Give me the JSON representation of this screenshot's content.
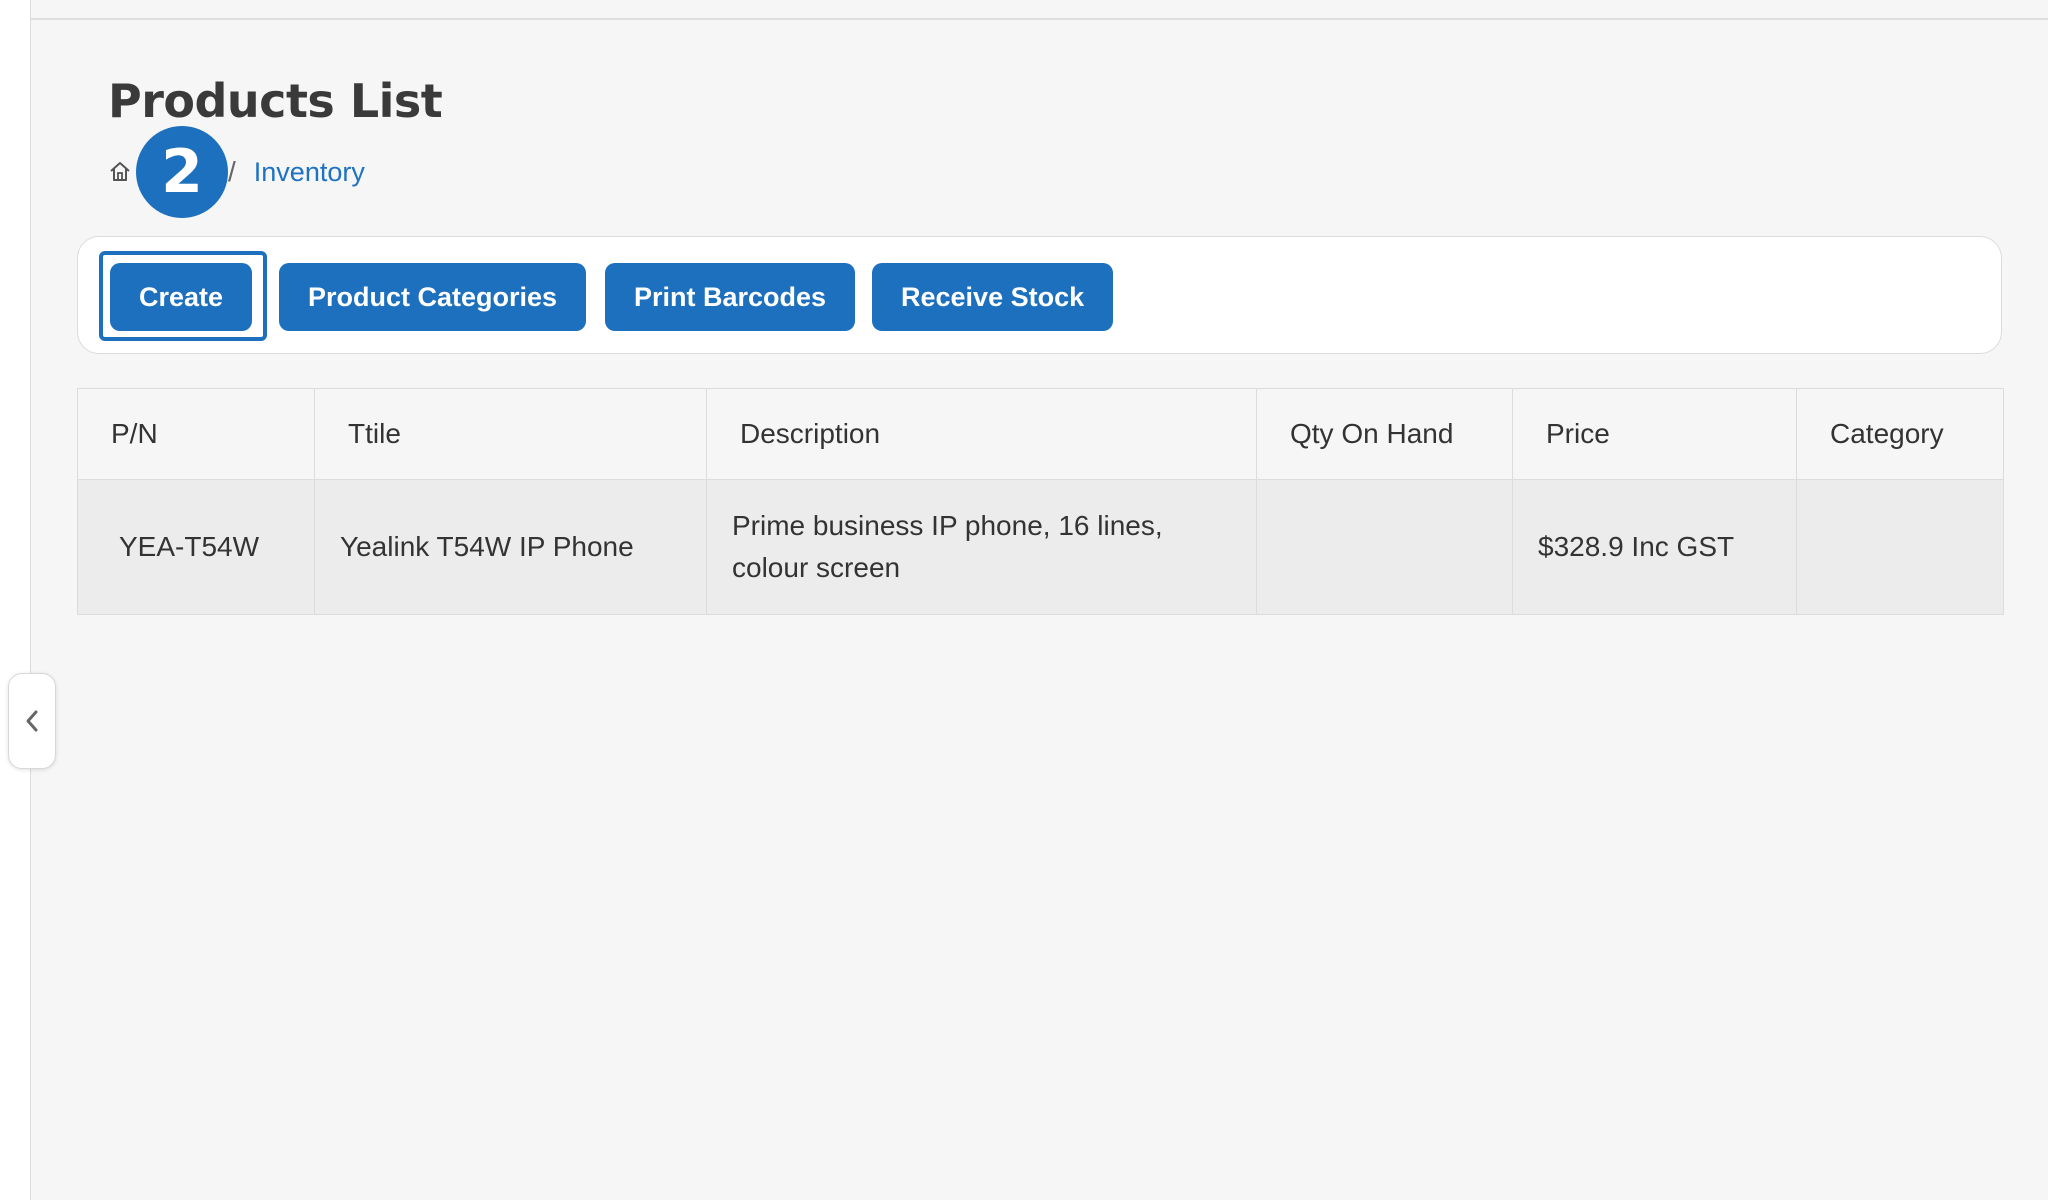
{
  "page": {
    "title": "Products List"
  },
  "breadcrumb": {
    "home_icon": "home-icon",
    "separator": "/",
    "current": "Inventory"
  },
  "step_badge": {
    "number": "2"
  },
  "toolbar": {
    "buttons": [
      {
        "label": "Create",
        "focused": true
      },
      {
        "label": "Product Categories"
      },
      {
        "label": "Print Barcodes"
      },
      {
        "label": "Receive Stock"
      }
    ]
  },
  "table": {
    "columns": [
      "P/N",
      "Ttile",
      "Description",
      "Qty On Hand",
      "Price",
      "Category"
    ],
    "rows": [
      [
        "YEA-T54W",
        "Yealink T54W IP Phone",
        "Prime business IP phone, 16 lines, colour screen",
        "",
        "$328.9 Inc GST",
        ""
      ]
    ]
  },
  "sidebar_toggle": {
    "icon": "chevron-left-icon"
  },
  "colors": {
    "accent": "#1d70bd",
    "link": "#1d72c2",
    "background": "#f6f6f6"
  }
}
